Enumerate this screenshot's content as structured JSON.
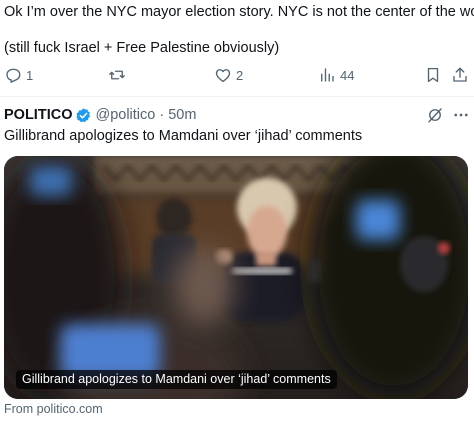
{
  "post": {
    "text_line1": "Ok I’m over the NYC mayor election story. NYC is not the center of the world",
    "text_line2": "(still fuck Israel + Free Palestine obviously)",
    "actions": {
      "reply_count": "1",
      "repost_count": "",
      "like_count": "2",
      "views_count": "44"
    }
  },
  "quoted": {
    "author_name": "POLITICO",
    "handle": "@politico",
    "separator": "·",
    "time": "50m",
    "headline": "Gillibrand apologizes to Mamdani over ‘jihad’ comments",
    "card": {
      "caption": "Gillibrand apologizes to Mamdani over ‘jihad’ comments",
      "source": "From politico.com"
    }
  },
  "colors": {
    "text_primary": "#0f1419",
    "text_secondary": "#536471",
    "verified_badge": "#1d9bf0",
    "divider": "#eff3f4"
  },
  "icons": [
    "reply-icon",
    "repost-icon",
    "like-icon",
    "views-icon",
    "bookmark-icon",
    "share-icon",
    "verified-icon",
    "grok-icon",
    "more-icon"
  ]
}
